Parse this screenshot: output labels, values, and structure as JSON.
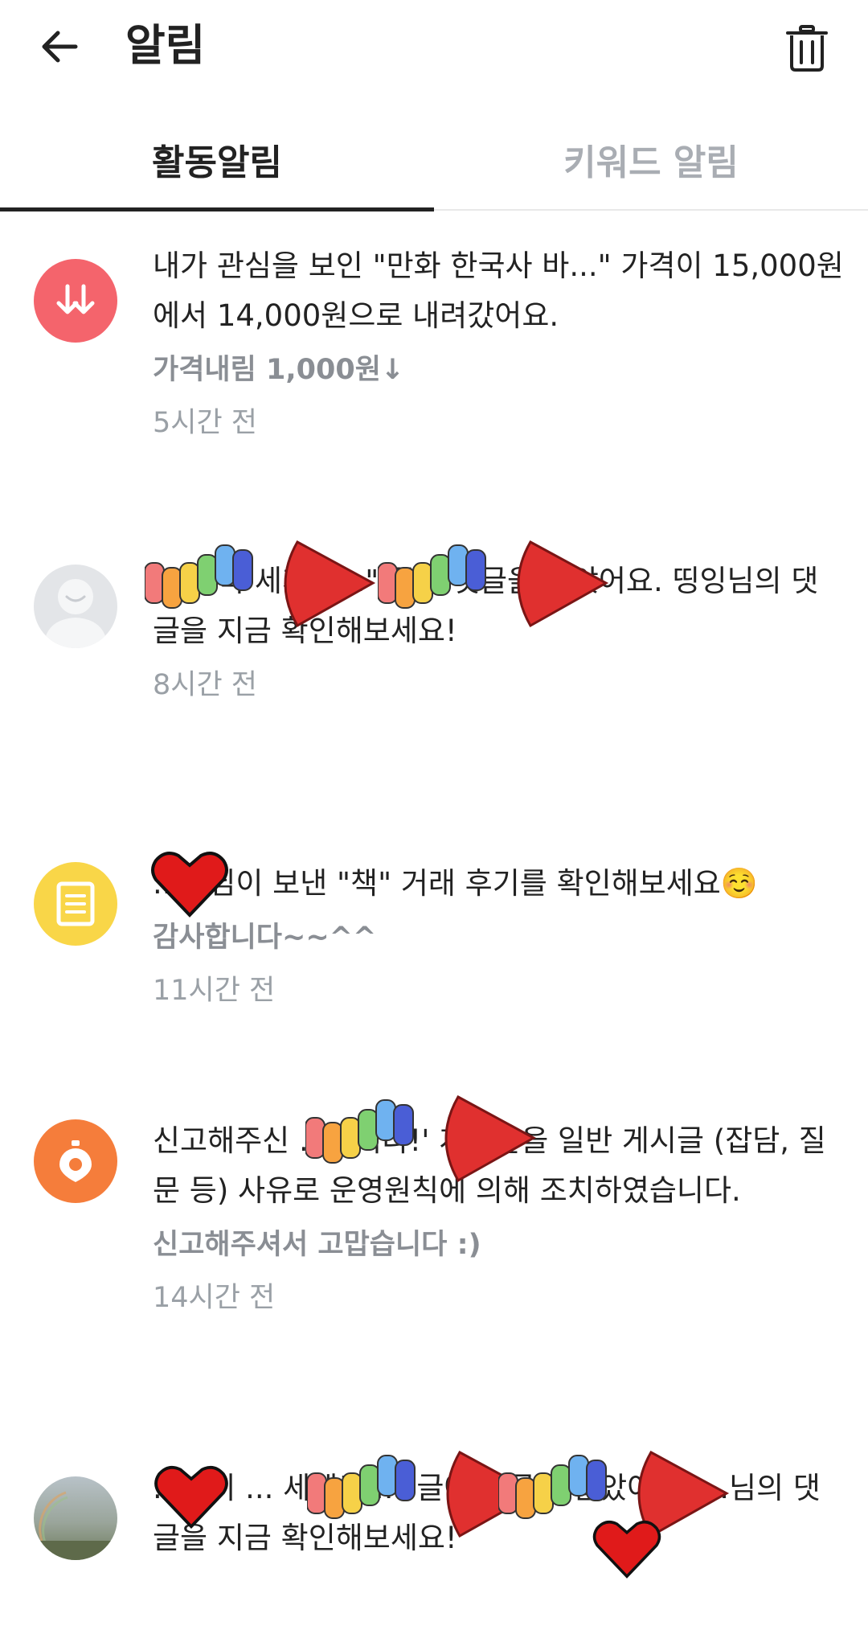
{
  "header": {
    "title": "알림",
    "back_icon": "arrow-left-icon",
    "trash_icon": "trash-icon"
  },
  "tabs": [
    {
      "label": "활동알림",
      "active": true
    },
    {
      "label": "키워드 알림",
      "active": false
    }
  ],
  "notifications": [
    {
      "icon": "price-down-icon",
      "icon_color": "#f4646c",
      "message": "내가 관심을 보인 \"만화 한국사 바...\" 가격이 15,000원에서 14,000원으로 내려갔어요.",
      "sub": "가격내림 1,000원↓",
      "time": "5시간 전"
    },
    {
      "icon": "profile-placeholder-icon",
      "icon_color": "#e3e5e8",
      "message": "...문 쪽 세계로...\" 글에 댓글을 달았어요. 띵잉님의 댓글을 지금 확인해보세요!",
      "time": "8시간 전"
    },
    {
      "icon": "review-document-icon",
      "icon_color": "#f9d648",
      "message": "...이님이 보낸 \"책\" 거래 후기를 확인해보세요☺️",
      "sub": "감사합니다~~^^",
      "time": "11시간 전"
    },
    {
      "icon": "report-siren-icon",
      "icon_color": "#f57d3b",
      "message": "신고해주신 ...합니다!' 게시글을 일반 게시글 (잡담, 질문 등) 사유로 운영원칙에 의해 조치하였습니다.",
      "sub": "신고해주셔서 고맙습니다 :)",
      "time": "14시간 전"
    },
    {
      "icon": "rainbow-photo-avatar",
      "icon_color": "#8a9a7a",
      "message": "...님이 ... 세계로...\" 글에 댓글을 달았어요. ...님의 댓글을 지금 확인해보세요!"
    }
  ],
  "colors": {
    "accent_text": "#222222",
    "inactive_tab": "#a9adb3",
    "muted_text": "#8a8e94"
  }
}
